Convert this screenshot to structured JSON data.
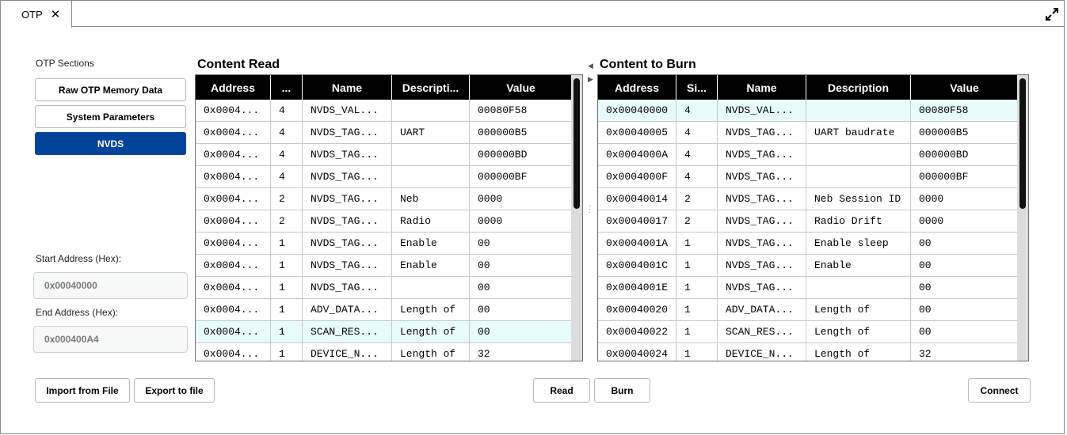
{
  "tab": {
    "label": "OTP",
    "close": "✕"
  },
  "sections": {
    "label": "OTP Sections",
    "buttons": [
      "Raw OTP Memory Data",
      "System Parameters",
      "NVDS"
    ]
  },
  "address": {
    "start_label": "Start Address (Hex):",
    "start_value": "0x00040000",
    "end_label": "End Address (Hex):",
    "end_value": "0x000400A4"
  },
  "content_read": {
    "title": "Content Read",
    "headers": [
      "Address",
      "...",
      "Name",
      "Descripti...",
      "Value"
    ],
    "rows": [
      [
        "0x0004...",
        "4",
        "NVDS_VAL...",
        "",
        "00080F58"
      ],
      [
        "0x0004...",
        "4",
        "NVDS_TAG...",
        "UART",
        "000000B5"
      ],
      [
        "0x0004...",
        "4",
        "NVDS_TAG...",
        "",
        "000000BD"
      ],
      [
        "0x0004...",
        "4",
        "NVDS_TAG...",
        "",
        "000000BF"
      ],
      [
        "0x0004...",
        "2",
        "NVDS_TAG...",
        "Neb",
        "0000"
      ],
      [
        "0x0004...",
        "2",
        "NVDS_TAG...",
        "Radio",
        "0000"
      ],
      [
        "0x0004...",
        "1",
        "NVDS_TAG...",
        "Enable",
        "00"
      ],
      [
        "0x0004...",
        "1",
        "NVDS_TAG...",
        "Enable",
        "00"
      ],
      [
        "0x0004...",
        "1",
        "NVDS_TAG...",
        "",
        "00"
      ],
      [
        "0x0004...",
        "1",
        "ADV_DATA...",
        "Length of",
        "00"
      ],
      [
        "0x0004...",
        "1",
        "SCAN_RES...",
        "Length of",
        "00"
      ],
      [
        "0x0004...",
        "1",
        "DEVICE_N...",
        "Length of",
        "32"
      ]
    ],
    "highlight_row": 10
  },
  "content_burn": {
    "title": "Content to Burn",
    "headers": [
      "Address",
      "Si...",
      "Name",
      "Description",
      "Value"
    ],
    "rows": [
      [
        "0x00040000",
        "4",
        "NVDS_VAL...",
        "",
        "00080F58"
      ],
      [
        "0x00040005",
        "4",
        "NVDS_TAG...",
        "UART baudrate",
        "000000B5"
      ],
      [
        "0x0004000A",
        "4",
        "NVDS_TAG...",
        "",
        "000000BD"
      ],
      [
        "0x0004000F",
        "4",
        "NVDS_TAG...",
        "",
        "000000BF"
      ],
      [
        "0x00040014",
        "2",
        "NVDS_TAG...",
        "Neb Session ID",
        "0000"
      ],
      [
        "0x00040017",
        "2",
        "NVDS_TAG...",
        "Radio Drift",
        "0000"
      ],
      [
        "0x0004001A",
        "1",
        "NVDS_TAG...",
        "Enable sleep",
        "00"
      ],
      [
        "0x0004001C",
        "1",
        "NVDS_TAG...",
        "Enable",
        "00"
      ],
      [
        "0x0004001E",
        "1",
        "NVDS_TAG...",
        "",
        "00"
      ],
      [
        "0x00040020",
        "1",
        "ADV_DATA...",
        "Length of",
        "00"
      ],
      [
        "0x00040022",
        "1",
        "SCAN_RES...",
        "Length of",
        "00"
      ],
      [
        "0x00040024",
        "1",
        "DEVICE_N...",
        "Length of",
        "32"
      ]
    ],
    "highlight_row": 0
  },
  "actions": {
    "import": "Import from File",
    "export": "Export to file",
    "read": "Read",
    "burn": "Burn",
    "connect": "Connect"
  },
  "colors": {
    "accent": "#00449a",
    "highlight": "#e8fbfb"
  }
}
